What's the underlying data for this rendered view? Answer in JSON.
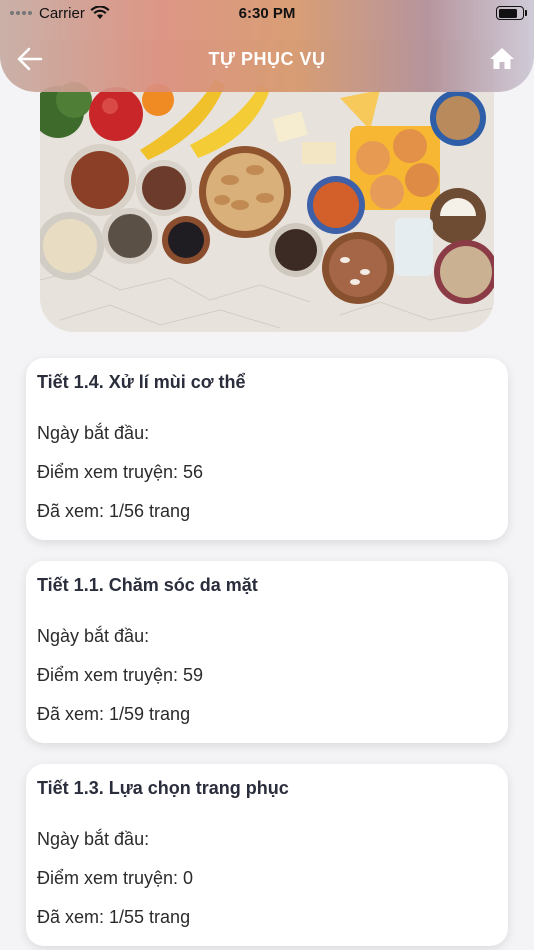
{
  "status_bar": {
    "carrier": "Carrier",
    "time": "6:30 PM"
  },
  "header": {
    "title": "TỰ PHỤC VỤ",
    "back_icon": "arrow-left-icon",
    "home_icon": "home-icon"
  },
  "banner": {
    "image": "food-ingredients-photo"
  },
  "cards": [
    {
      "title": "Tiết 1.4. Xử lí mùi cơ thể",
      "start_date": "Ngày bắt đầu:",
      "points": "Điểm xem truyện: 56",
      "viewed": "Đã xem: 1/56 trang"
    },
    {
      "title": "Tiết 1.1. Chăm sóc da mặt",
      "start_date": "Ngày bắt đầu:",
      "points": "Điểm xem truyện: 59",
      "viewed": "Đã xem: 1/59 trang"
    },
    {
      "title": "Tiết 1.3. Lựa chọn trang phục",
      "start_date": "Ngày bắt đầu:",
      "points": "Điểm xem truyện: 0",
      "viewed": "Đã xem: 1/55 trang"
    }
  ],
  "colors": {
    "header_text": "#ffffff",
    "card_bg": "#ffffff",
    "page_bg": "#f4f4f6",
    "title_text": "#2a2d3b"
  }
}
